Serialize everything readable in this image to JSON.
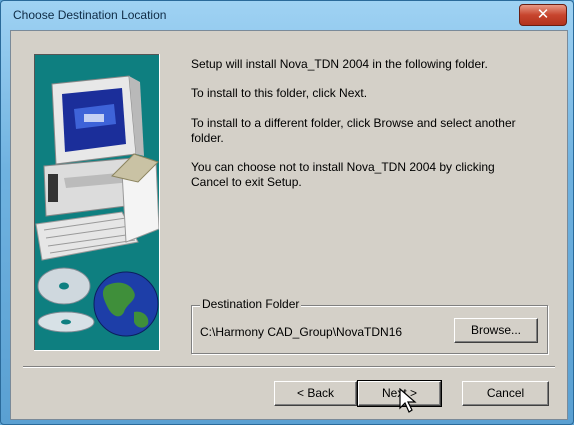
{
  "window": {
    "title": "Choose Destination Location",
    "close_glyph": "✕"
  },
  "messages": {
    "line1": "Setup will install Nova_TDN 2004 in the following folder.",
    "line2": "To install to this folder, click Next.",
    "line3": "To install to a different folder, click Browse and select another folder.",
    "line4": "You can choose not to install Nova_TDN 2004 by clicking Cancel to exit Setup."
  },
  "destination": {
    "group_label": "Destination Folder",
    "path": "C:\\Harmony CAD_Group\\NovaTDN16",
    "browse_label": "Browse..."
  },
  "buttons": {
    "back_label": "< Back",
    "next_label": "Next >",
    "cancel_label": "Cancel"
  },
  "art": {
    "background_color": "#0e7f80",
    "icons": [
      "computer-icon",
      "cd-discs-icon",
      "globe-icon",
      "box-icon"
    ]
  },
  "icons": {
    "close": "close-icon",
    "cursor": "mouse-pointer-icon"
  }
}
